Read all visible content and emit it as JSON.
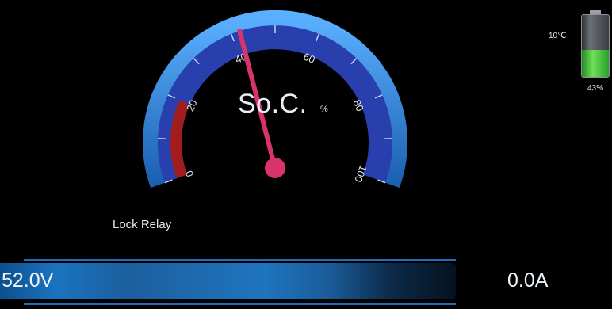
{
  "gauge": {
    "title": "So.C.",
    "unit": "%",
    "value": 42,
    "min": 0,
    "max": 100,
    "ticks": [
      "0",
      "20",
      "40",
      "60",
      "80",
      "100"
    ],
    "red_zone_max": 20,
    "colors": {
      "arc": "#2f86de",
      "red_zone": "#a11c1c",
      "needle": "#d8336a"
    }
  },
  "battery": {
    "temperature": "10℃",
    "percent_label": "43%",
    "level": 0.43,
    "fill_color": "#55d144"
  },
  "status_label": "Lock Relay",
  "bar": {
    "voltage": "52.0V",
    "current": "0.0A",
    "accent": "#1a73c0"
  }
}
